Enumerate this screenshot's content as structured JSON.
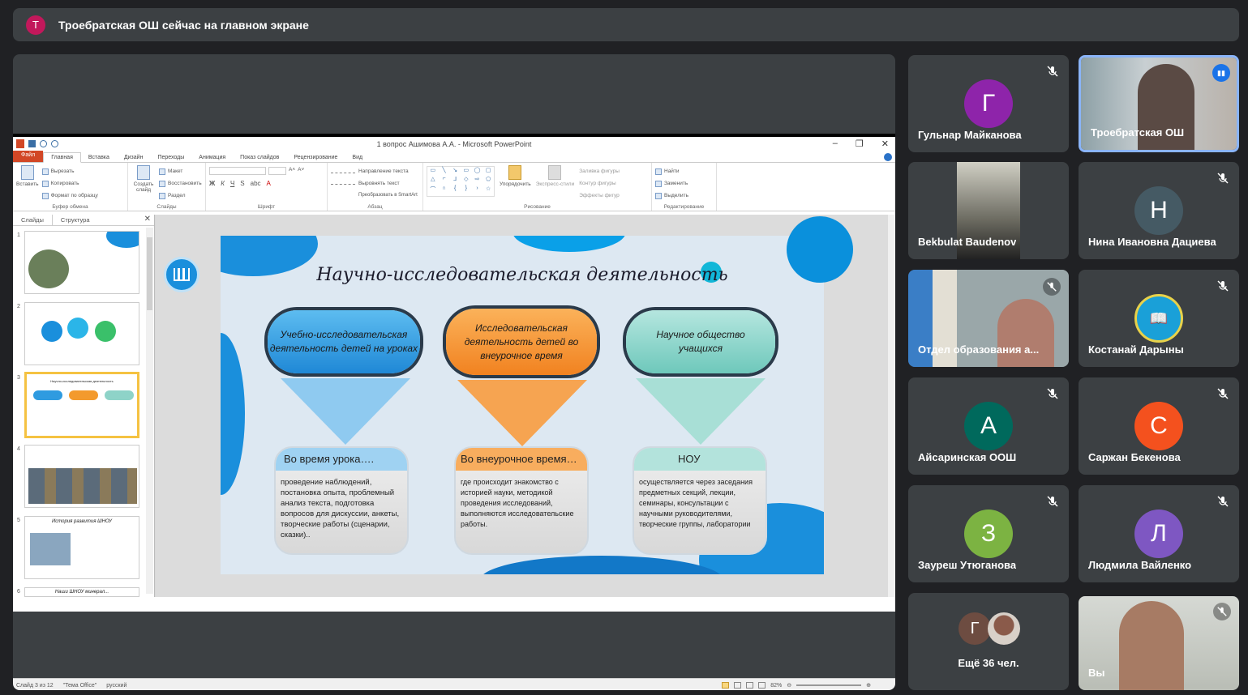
{
  "presenter_banner": {
    "avatar_letter": "Т",
    "text": "Троебратская ОШ сейчас на главном экране"
  },
  "ppt": {
    "title": "1 вопрос Ашимова А.А. - Microsoft PowerPoint",
    "tabs": [
      "Файл",
      "Главная",
      "Вставка",
      "Дизайн",
      "Переходы",
      "Анимация",
      "Показ слайдов",
      "Рецензирование",
      "Вид"
    ],
    "ribbon": {
      "clipboard": {
        "label": "Буфер обмена",
        "paste": "Вставить",
        "cut": "Вырезать",
        "copy": "Копировать",
        "format": "Формат по образцу"
      },
      "slides": {
        "label": "Слайды",
        "create": "Создать слайд",
        "layout": "Макет",
        "reset": "Восстановить",
        "section": "Раздел"
      },
      "font": {
        "label": "Шрифт"
      },
      "paragraph": {
        "label": "Абзац",
        "text_dir": "Направление текста",
        "align_text": "Выровнять текст",
        "smartart": "Преобразовать в SmartArt"
      },
      "drawing": {
        "label": "Рисование",
        "arrange": "Упорядочить",
        "styles": "Экспресс-стили",
        "fill": "Заливка фигуры",
        "outline": "Контур фигуры",
        "effects": "Эффекты фигур"
      },
      "editing": {
        "label": "Редактирование",
        "find": "Найти",
        "replace": "Заменить",
        "select": "Выделить"
      }
    },
    "pane_tabs": [
      "Слайды",
      "Структура"
    ],
    "thumb_numbers": [
      "1",
      "2",
      "3",
      "4",
      "5",
      "6"
    ],
    "thumb_captions": {
      "t3": "Научно-исследовательская деятельность",
      "t5": "История развития ШНОУ",
      "t6": "Наши ШНОУ минерал..."
    },
    "slide": {
      "title": "Научно-исследовательская деятельность",
      "pills": [
        {
          "text": "Учебно-исследовательская деятельность детей на уроках"
        },
        {
          "text": "Исследовательская деятельность детей во внеурочное время"
        },
        {
          "text": "Научное общество учащихся"
        }
      ],
      "cards": [
        {
          "head": "Во время урока….",
          "body": "проведение наблюдений, постановка опыта, проблемный анализ текста, подготовка вопросов для дискуссии, анкеты, творческие работы (сценарии, сказки).."
        },
        {
          "head": "Во внеурочное время…",
          "body": "где происходит знакомство с историей науки, методикой проведения исследований, выполняются исследовательские работы."
        },
        {
          "head": "НОУ",
          "body": "осуществляется через заседания предметных секций, лекции, семинары, консультации с научными руководителями, творческие группы, лаборатории"
        }
      ]
    },
    "status": {
      "slide": "Слайд 3 из 12",
      "theme": "\"Тема Office\"",
      "lang": "русский",
      "zoom": "82%"
    }
  },
  "participants": [
    {
      "name": "Гульнар Майканова",
      "letter": "Г",
      "color": "#8e24aa",
      "muted": true
    },
    {
      "name": "Троебратская ОШ",
      "speaking": true
    },
    {
      "name": "Bekbulat Baudenov"
    },
    {
      "name": "Нина Ивановна Дациева",
      "letter": "Н",
      "color": "#455a64",
      "muted": true
    },
    {
      "name": "Отдел образования а...",
      "muted": true
    },
    {
      "name": "Костанай Дарыны",
      "muted": true
    },
    {
      "name": "Айсаринская ООШ",
      "letter": "А",
      "color": "#00695c",
      "muted": true
    },
    {
      "name": "Саржан Бекенова",
      "letter": "С",
      "color": "#f4511e",
      "muted": true
    },
    {
      "name": "Зауреш Утюганова",
      "letter": "З",
      "color": "#7cb342",
      "muted": true
    },
    {
      "name": "Людмила Вайленко",
      "letter": "Л",
      "color": "#7e57c2",
      "muted": true
    },
    {
      "name": "Ещё 36 чел.",
      "letter": "Г",
      "color": "#6d4c41"
    },
    {
      "name": "Вы",
      "muted": true
    }
  ]
}
